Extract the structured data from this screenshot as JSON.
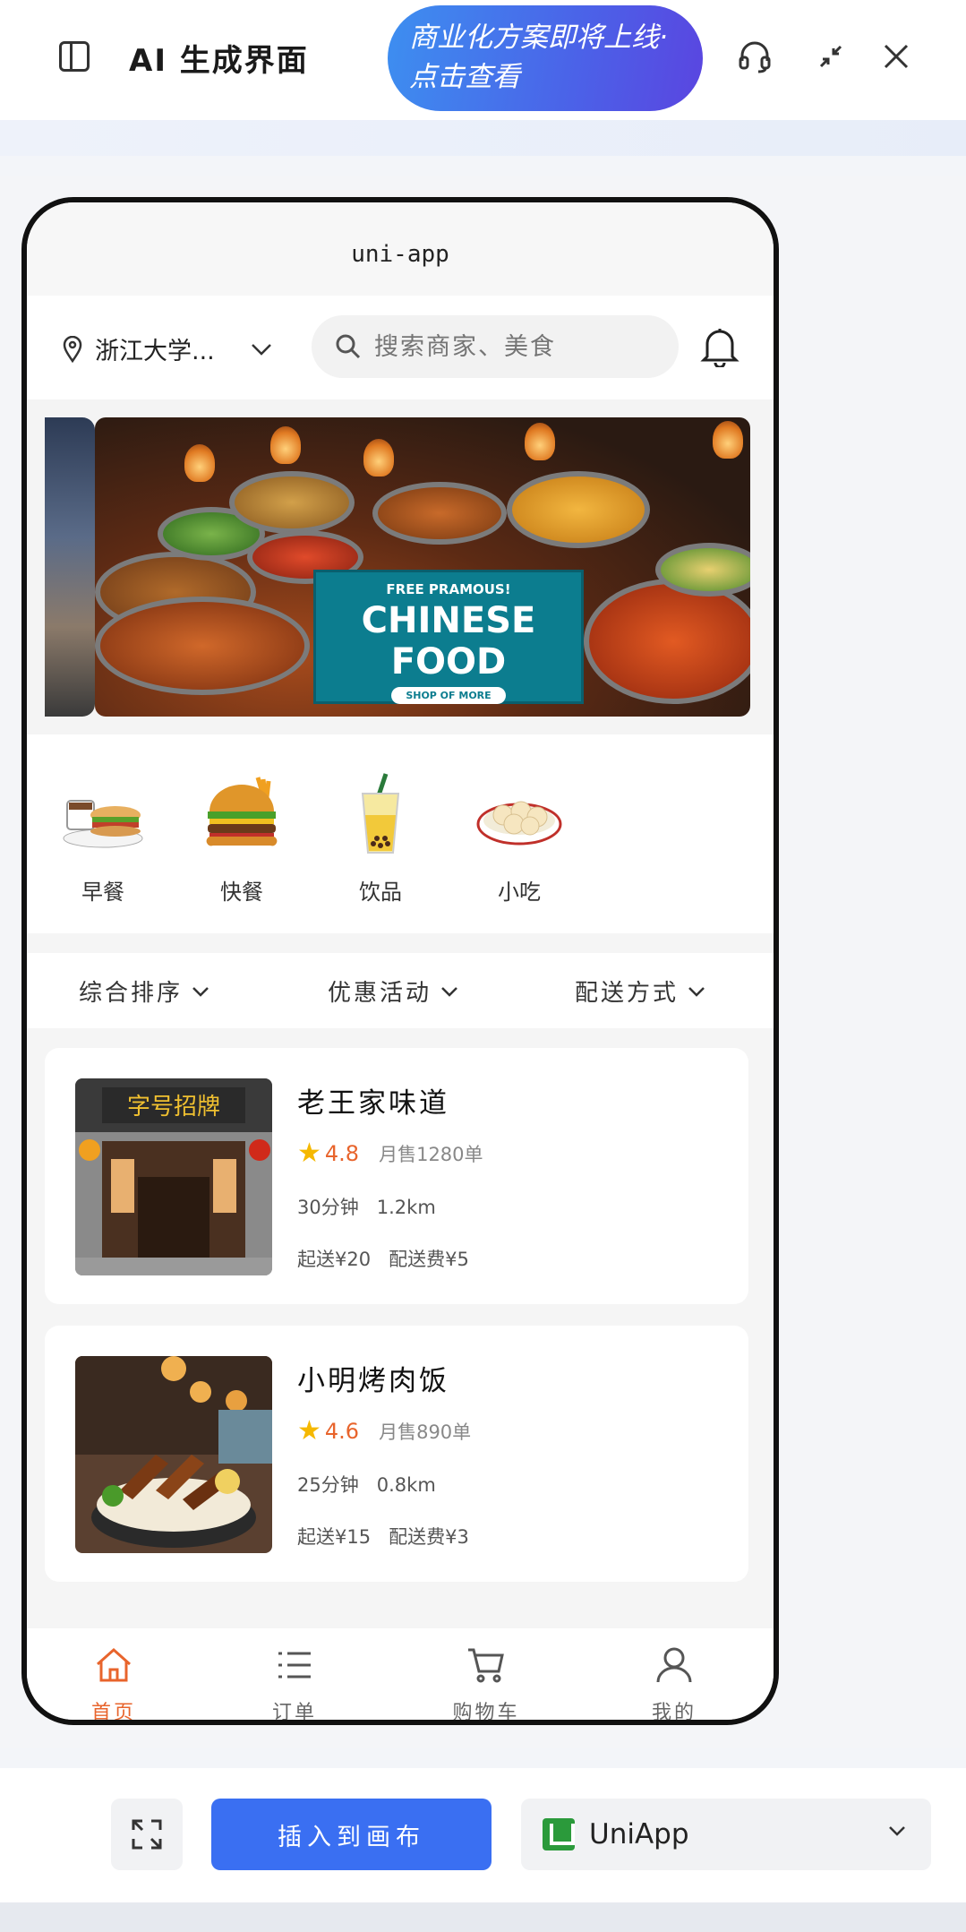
{
  "app": {
    "title": "AI 生成界面"
  },
  "promo": {
    "line1": "商业化方案即将上线·",
    "line2": "点击查看"
  },
  "phone": {
    "nav_title": "uni-app",
    "location": "浙江大学...",
    "search_placeholder": "搜索商家、美食",
    "banner": {
      "small": "FREE PRAMOUS!",
      "title_line1": "CHINESE",
      "title_line2": "FOOD",
      "cta": "SHOP OF MORE"
    },
    "categories": [
      {
        "label": "早餐",
        "icon": "breakfast-icon"
      },
      {
        "label": "快餐",
        "icon": "burger-icon"
      },
      {
        "label": "饮品",
        "icon": "drink-icon"
      },
      {
        "label": "小吃",
        "icon": "dumpling-icon"
      }
    ],
    "filters": [
      {
        "label": "综合排序"
      },
      {
        "label": "优惠活动"
      },
      {
        "label": "配送方式"
      }
    ],
    "shops": [
      {
        "name": "老王家味道",
        "rating": "4.8",
        "sales": "月售1280单",
        "time": "30分钟",
        "distance": "1.2km",
        "min_order": "起送¥20",
        "delivery_fee": "配送费¥5"
      },
      {
        "name": "小明烤肉饭",
        "rating": "4.6",
        "sales": "月售890单",
        "time": "25分钟",
        "distance": "0.8km",
        "min_order": "起送¥15",
        "delivery_fee": "配送费¥3"
      }
    ],
    "tabs": [
      {
        "label": "首页",
        "icon": "home-icon",
        "active": true
      },
      {
        "label": "订单",
        "icon": "list-icon",
        "active": false
      },
      {
        "label": "购物车",
        "icon": "cart-icon",
        "active": false
      },
      {
        "label": "我的",
        "icon": "user-icon",
        "active": false
      }
    ]
  },
  "toolbar": {
    "insert_label": "插入到画布",
    "framework": "UniApp"
  },
  "colors": {
    "accent": "#3a6ff2",
    "active_tab": "#e8642c",
    "star": "#f5b800",
    "banner_sign": "#0c7d8f"
  }
}
